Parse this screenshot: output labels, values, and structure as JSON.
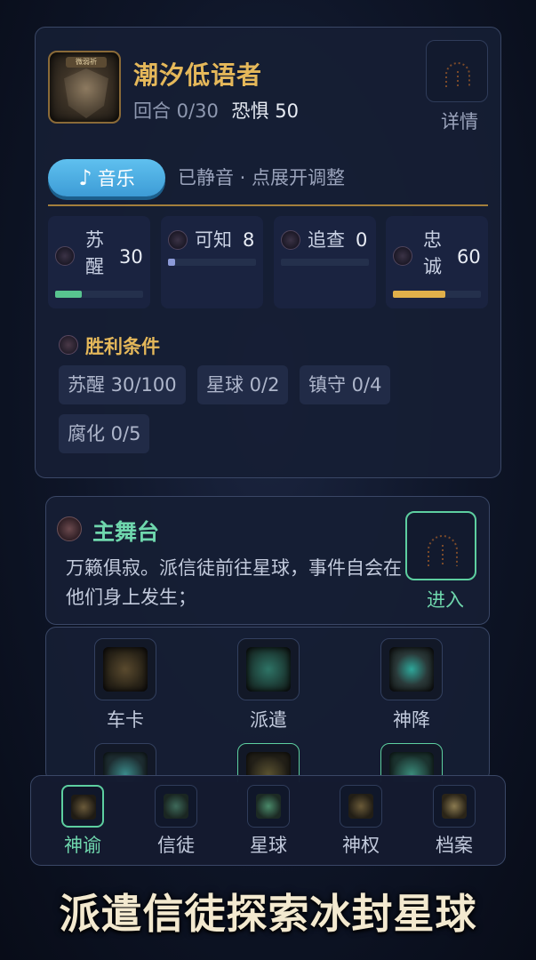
{
  "header": {
    "title": "潮汐低语者",
    "emblem_text": "微弱祈",
    "round_text": "回合 0/30",
    "fear_text": "恐惧 50",
    "detail_label": "详情",
    "music_label": "音乐",
    "music_status": "已静音 · 点展开调整"
  },
  "stats": [
    {
      "label": "苏醒",
      "value": "30",
      "fill_pct": 30,
      "color": "#58c48f"
    },
    {
      "label": "可知",
      "value": "8",
      "fill_pct": 8,
      "color": "#8c9ad8"
    },
    {
      "label": "追查",
      "value": "0",
      "fill_pct": 0,
      "color": "#8c9ad8"
    },
    {
      "label": "忠诚",
      "value": "60",
      "fill_pct": 60,
      "color": "#e0b04a"
    }
  ],
  "victory": {
    "title": "胜利条件",
    "conditions": [
      "苏醒 30/100",
      "星球 0/2",
      "镇守 0/4",
      "腐化 0/5"
    ]
  },
  "stage": {
    "title": "主舞台",
    "description": "万籁俱寂。派信徒前往星球，事件自会在他们身上发生；",
    "enter_label": "进入"
  },
  "actions": [
    {
      "label": "车卡",
      "icon": "card-deck-icon"
    },
    {
      "label": "派遣",
      "icon": "dispatch-icon"
    },
    {
      "label": "神降",
      "icon": "descent-icon"
    },
    {
      "label": "",
      "icon": "eye-icon"
    },
    {
      "label": "",
      "icon": "orb-icon"
    },
    {
      "label": "",
      "icon": "crystal-icon"
    }
  ],
  "nav": [
    {
      "label": "神谕",
      "icon": "oracle-icon",
      "active": true
    },
    {
      "label": "信徒",
      "icon": "believers-icon",
      "active": false
    },
    {
      "label": "星球",
      "icon": "planet-icon",
      "active": false
    },
    {
      "label": "神权",
      "icon": "divine-power-icon",
      "active": false
    },
    {
      "label": "档案",
      "icon": "archive-icon",
      "active": false
    }
  ],
  "slogan": "派遣信徒探索冰封星球"
}
